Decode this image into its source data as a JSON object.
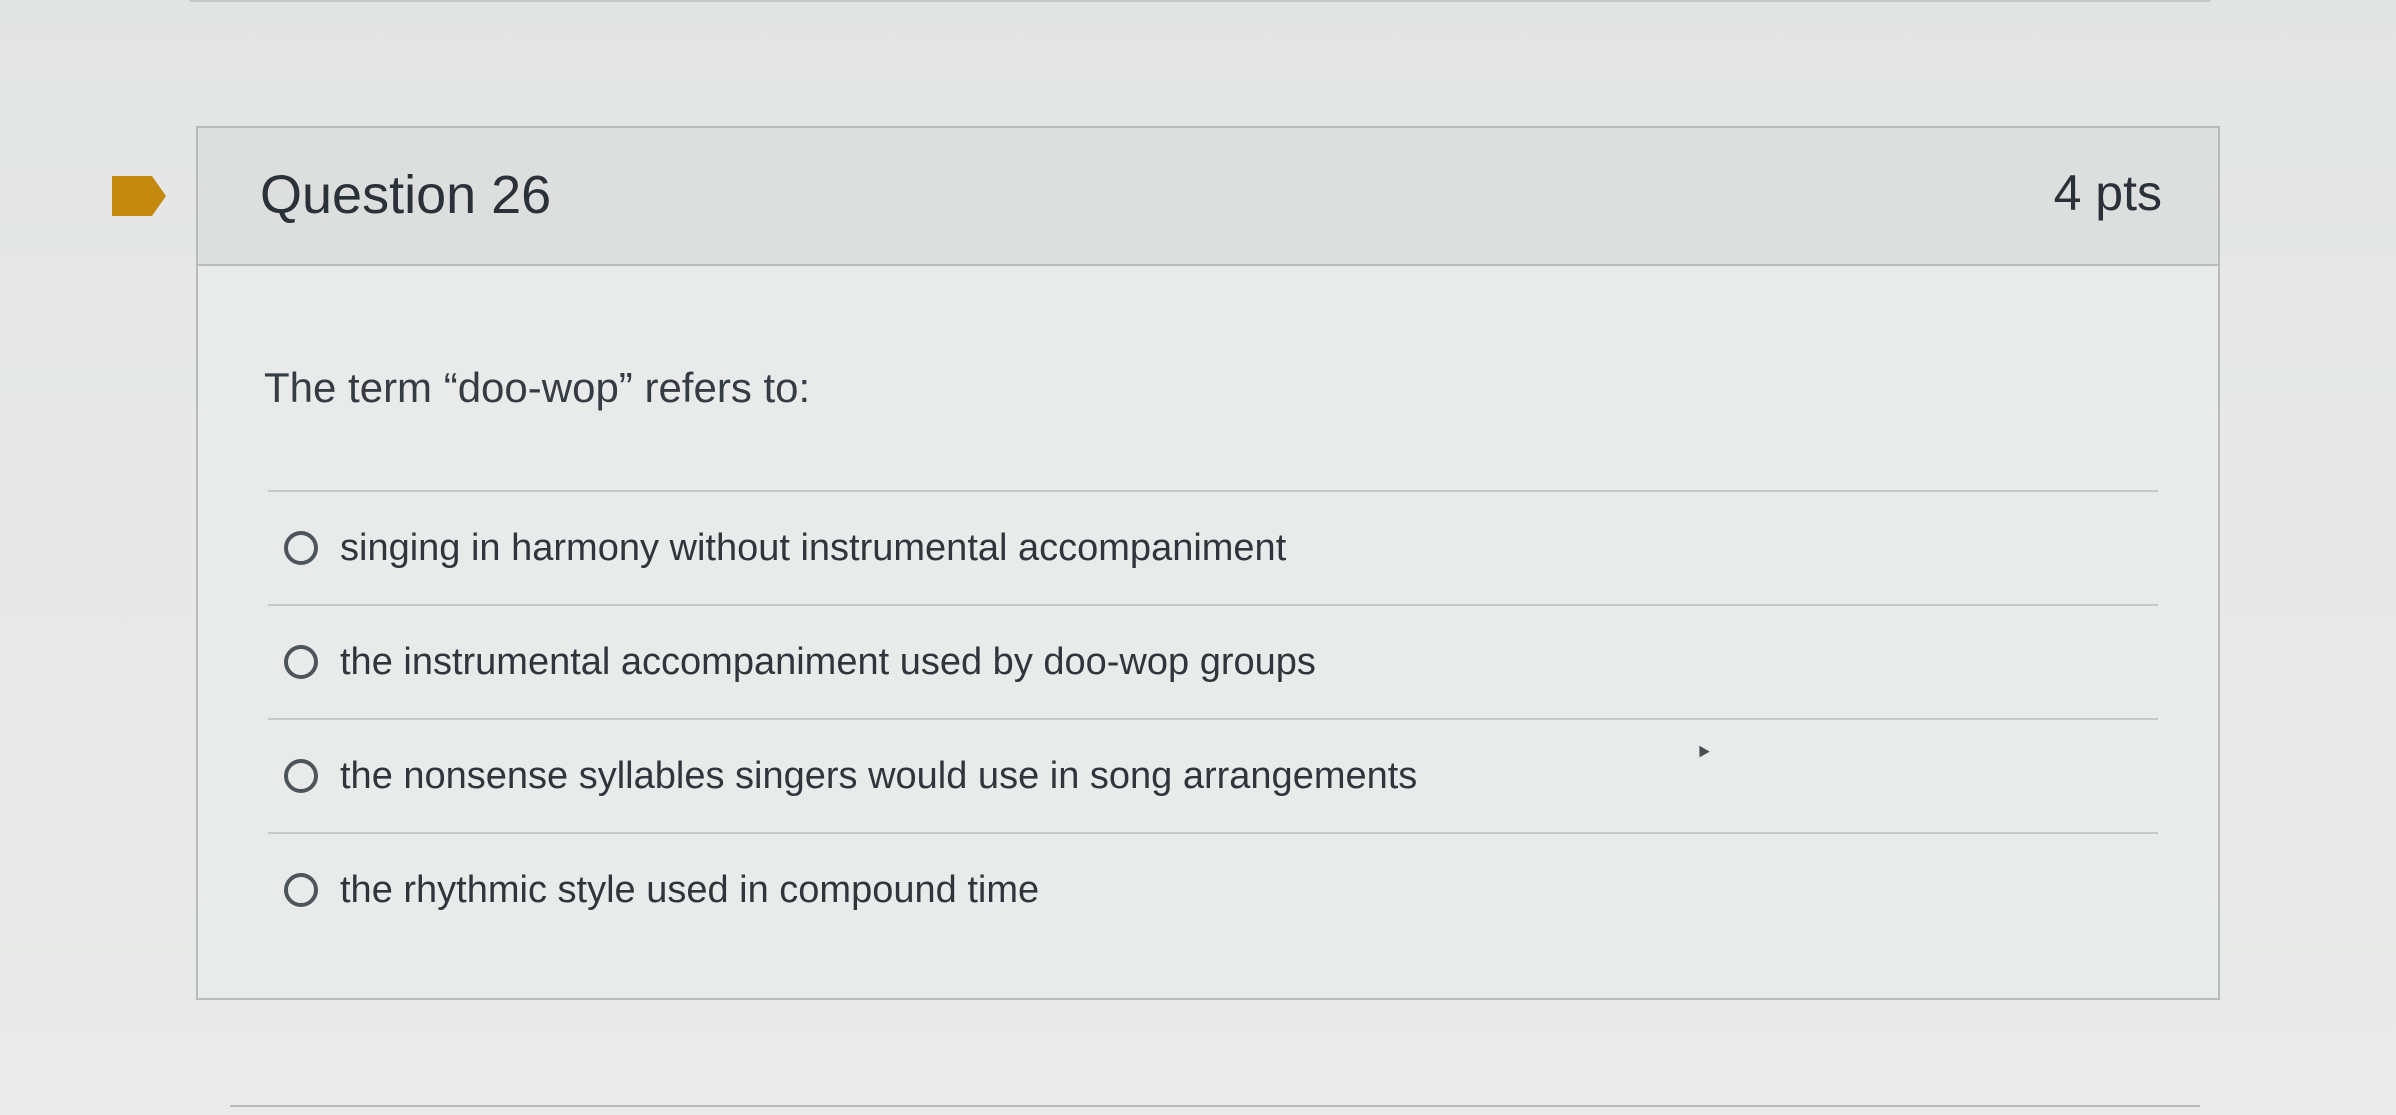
{
  "question": {
    "title": "Question 26",
    "points": "4 pts",
    "prompt": "The term “doo-wop” refers to:",
    "flag_icon": "flag-icon",
    "answers": [
      "singing in harmony without instrumental accompaniment",
      "the instrumental accompaniment used by doo-wop groups",
      "the nonsense syllables singers would use in song arrangements",
      "the rhythmic style used in compound time"
    ]
  },
  "colors": {
    "flag": "#c48a10",
    "header": "#dddfde",
    "body": "#e9ebea",
    "border": "#b8bbbb"
  }
}
